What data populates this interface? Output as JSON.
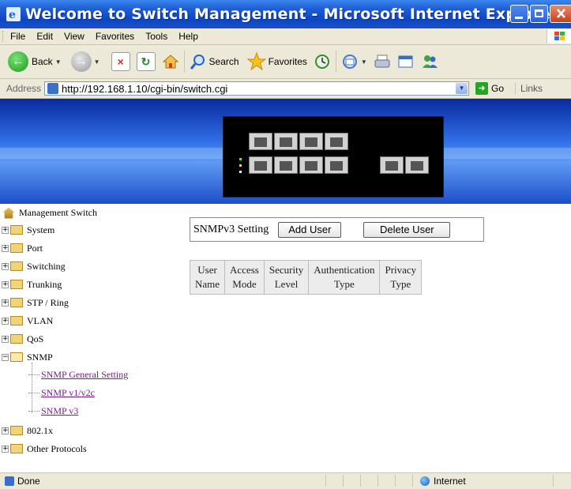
{
  "window": {
    "title": "Welcome to Switch Management - Microsoft Internet Explorer"
  },
  "menu": [
    "File",
    "Edit",
    "View",
    "Favorites",
    "Tools",
    "Help"
  ],
  "toolbar": {
    "back_label": "Back",
    "search_label": "Search",
    "favorites_label": "Favorites"
  },
  "address": {
    "label": "Address",
    "url": "http://192.168.1.10/cgi-bin/switch.cgi",
    "go_label": "Go",
    "links_label": "Links"
  },
  "sidebar": {
    "root_label": "Management Switch",
    "items": [
      {
        "label": "System",
        "expanded": false
      },
      {
        "label": "Port",
        "expanded": false
      },
      {
        "label": "Switching",
        "expanded": false
      },
      {
        "label": "Trunking",
        "expanded": false
      },
      {
        "label": "STP / Ring",
        "expanded": false
      },
      {
        "label": "VLAN",
        "expanded": false
      },
      {
        "label": "QoS",
        "expanded": false
      },
      {
        "label": "SNMP",
        "expanded": true
      },
      {
        "label": "802.1x",
        "expanded": false
      },
      {
        "label": "Other Protocols",
        "expanded": false
      }
    ],
    "snmp_children": [
      "SNMP General Setting",
      "SNMP v1/v2c",
      "SNMP v3"
    ]
  },
  "main": {
    "section_label": "SNMPv3 Setting",
    "add_user_label": "Add User",
    "delete_user_label": "Delete User",
    "table_headers": [
      [
        "User",
        "Name"
      ],
      [
        "Access",
        "Mode"
      ],
      [
        "Security",
        "Level"
      ],
      [
        "Authentication",
        "Type"
      ],
      [
        "Privacy",
        "Type"
      ]
    ]
  },
  "status": {
    "text": "Done",
    "zone": "Internet"
  },
  "colors": {
    "titlebar": "#0d46c4",
    "chrome": "#ece9d8",
    "visited_link": "#7a1a8a"
  }
}
